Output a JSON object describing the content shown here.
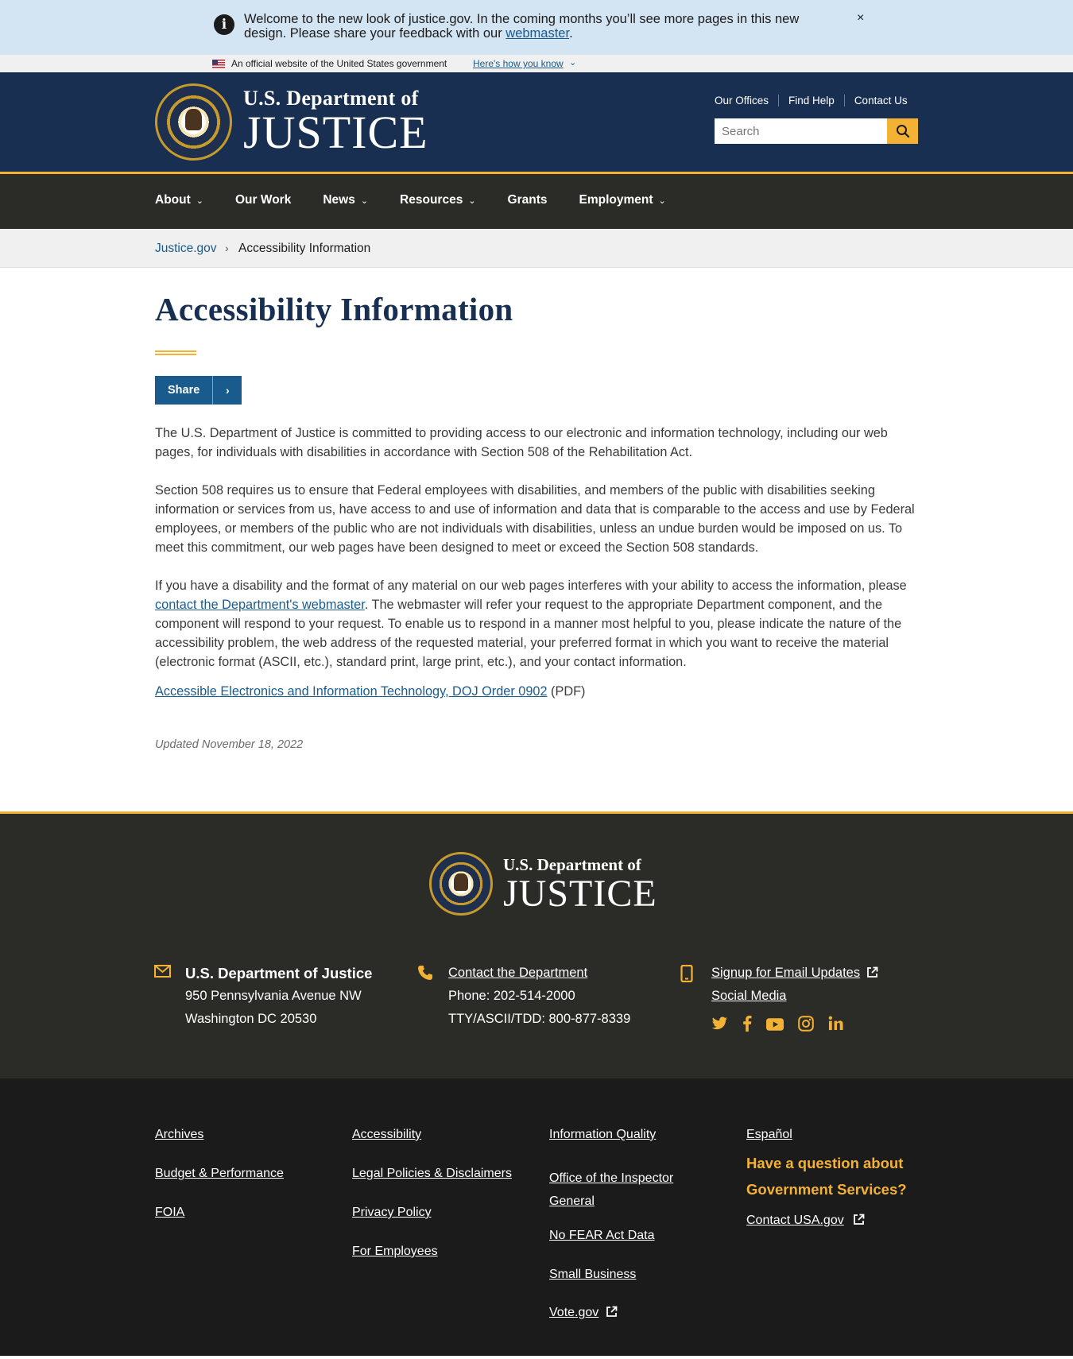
{
  "alert": {
    "message": "Welcome to the new look of justice.gov. In the coming months you’ll see more pages in this new design. Please share your feedback with our ",
    "link": "webmaster",
    "end": ".",
    "close": "×"
  },
  "gov_banner": {
    "official": "An official website of the United States government",
    "how": "Here's how you know"
  },
  "header": {
    "dept_line": "U.S. Department of",
    "name": "JUSTICE",
    "utility": [
      "Our Offices",
      "Find Help",
      "Contact Us"
    ],
    "search_placeholder": "Search"
  },
  "nav": [
    {
      "label": "About",
      "chevron": true
    },
    {
      "label": "Our Work",
      "chevron": false
    },
    {
      "label": "News",
      "chevron": true
    },
    {
      "label": "Resources",
      "chevron": true
    },
    {
      "label": "Grants",
      "chevron": false
    },
    {
      "label": "Employment",
      "chevron": true
    }
  ],
  "breadcrumb": {
    "home": "Justice.gov",
    "current": "Accessibility Information"
  },
  "page": {
    "title": "Accessibility Information",
    "share": "Share",
    "p1": "The U.S. Department of Justice is committed to providing access to our electronic and information technology, including our web pages, for individuals with disabilities in accordance with Section 508 of the Rehabilitation Act.",
    "p2": "Section 508 requires us to ensure that Federal employees with disabilities, and members of the public with disabilities seeking information or services from us, have access to and use of information and data that is comparable to the access and use by Federal employees, or members of the public who are not individuals with disabilities, unless an undue burden would be imposed on us. To meet this commitment, our web pages have been designed to meet or exceed the Section 508 standards.",
    "p3_before": "If you have a disability and the format of any material on our web pages interferes with your ability to access the information, please ",
    "p3_link": "contact the Department's webmaster",
    "p3_after": ".  The webmaster will refer your request to the appropriate Department component, and the component will respond to your request. To enable us to respond in a manner most helpful to you, please indicate the nature of the accessibility problem, the web address of the requested material, your preferred format in which you want to receive the material (electronic format (ASCII, etc.), standard print, large print, etc.), and your contact information.",
    "doc_link": "Accessible Electronics and Information Technology, DOJ Order 0902",
    "doc_suffix": " (PDF)",
    "updated": "Updated November 18, 2022"
  },
  "footer": {
    "dept_line": "U.S. Department of",
    "name": "JUSTICE",
    "address": {
      "org": "U.S. Department of Justice",
      "line1": "950 Pennsylvania Avenue NW",
      "line2": "Washington DC 20530"
    },
    "contact": {
      "link": "Contact the Department",
      "phone": "Phone: 202-514-2000",
      "tty": "TTY/ASCII/TDD: 800-877-8339"
    },
    "updates": {
      "email": "Signup for Email Updates",
      "social": "Social Media"
    },
    "social_icons": [
      "twitter-icon",
      "facebook-icon",
      "youtube-icon",
      "instagram-icon",
      "linkedin-icon"
    ],
    "links": {
      "col1": [
        "Archives",
        "Budget & Performance",
        "FOIA"
      ],
      "col2": [
        "Accessibility",
        "Legal Policies & Disclaimers",
        "Privacy Policy",
        "For Employees"
      ],
      "col3": [
        "Information Quality",
        "Office of the Inspector General",
        "No FEAR Act Data",
        "Small Business",
        "Vote.gov"
      ],
      "col4": [
        "Español"
      ]
    },
    "ask": "Have a question about Government Services?",
    "usa": "Contact USA.gov"
  },
  "colors": {
    "navy": "#182f51",
    "gold": "#f3b233",
    "nav_bg": "#2b2c28",
    "link": "#1a5b8e",
    "footer_bottom": "#1b1b1b"
  }
}
